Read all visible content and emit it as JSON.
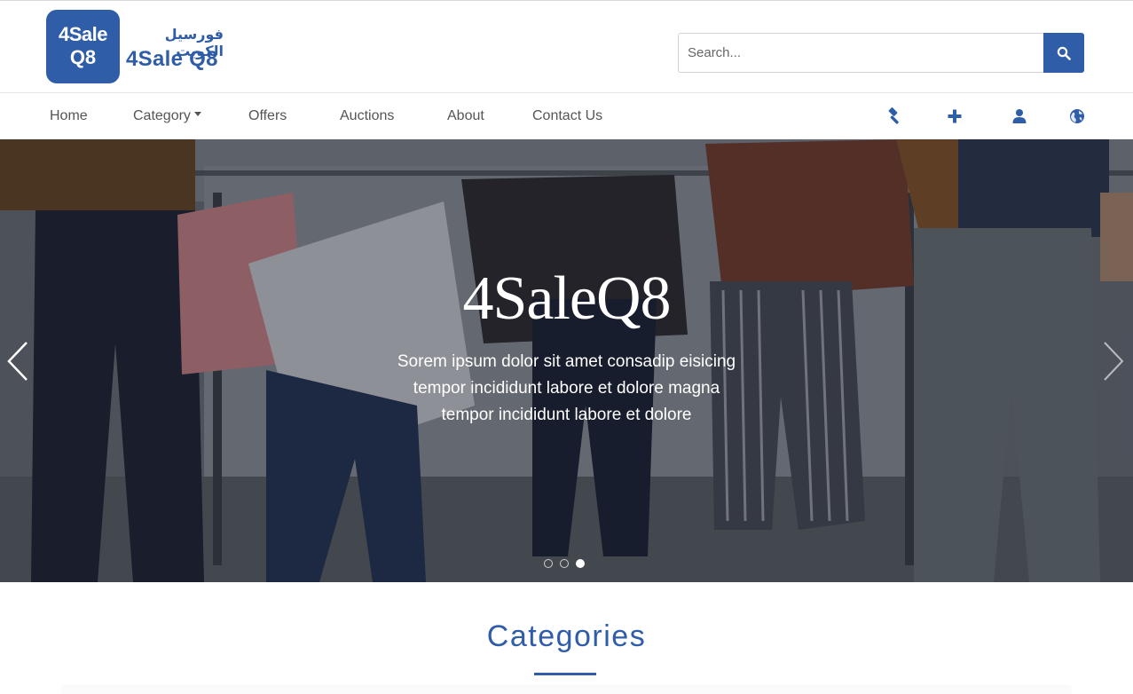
{
  "header": {
    "logo": {
      "box_line1": "4Sale",
      "box_line2": "Q8",
      "arabic_name": "فورسيل الكويت",
      "english_name": "4Sale Q8"
    },
    "search": {
      "placeholder": "Search...",
      "value": "",
      "button_icon": "search-icon"
    }
  },
  "nav": {
    "items": [
      {
        "label": "Home"
      },
      {
        "label": "Category",
        "dropdown": true
      },
      {
        "label": "Offers"
      },
      {
        "label": "Auctions"
      },
      {
        "label": "About"
      },
      {
        "label": "Contact Us"
      }
    ],
    "icons": [
      "gavel-icon",
      "plus-icon",
      "user-icon",
      "globe-icon"
    ]
  },
  "hero": {
    "title": "4SaleQ8",
    "text_line1": "Sorem ipsum dolor sit amet consadip eisicing",
    "text_line2": "tempor incididunt labore et dolore magna",
    "text_line3": "tempor incididunt labore et dolore",
    "slide_count": 3,
    "active_slide": 3,
    "prev_icon": "chevron-left-icon",
    "next_icon": "chevron-right-icon"
  },
  "categories": {
    "title": "Categories"
  },
  "colors": {
    "brand": "#2f5da8",
    "nav_text": "#555555",
    "hero_text": "#ffffff"
  }
}
